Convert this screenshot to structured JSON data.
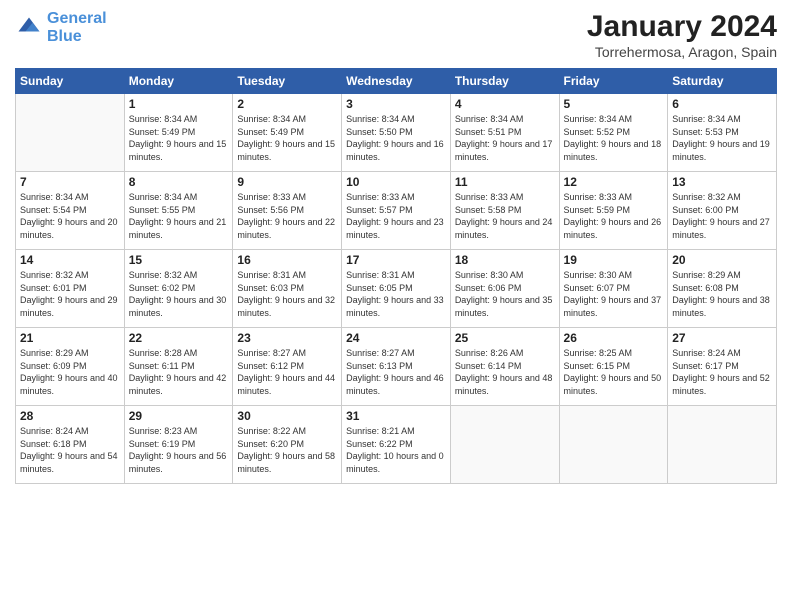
{
  "header": {
    "logo_line1": "General",
    "logo_line2": "Blue",
    "month_year": "January 2024",
    "location": "Torrehermosa, Aragon, Spain"
  },
  "days_of_week": [
    "Sunday",
    "Monday",
    "Tuesday",
    "Wednesday",
    "Thursday",
    "Friday",
    "Saturday"
  ],
  "weeks": [
    [
      {
        "num": "",
        "detail": ""
      },
      {
        "num": "1",
        "detail": "Sunrise: 8:34 AM\nSunset: 5:49 PM\nDaylight: 9 hours\nand 15 minutes."
      },
      {
        "num": "2",
        "detail": "Sunrise: 8:34 AM\nSunset: 5:49 PM\nDaylight: 9 hours\nand 15 minutes."
      },
      {
        "num": "3",
        "detail": "Sunrise: 8:34 AM\nSunset: 5:50 PM\nDaylight: 9 hours\nand 16 minutes."
      },
      {
        "num": "4",
        "detail": "Sunrise: 8:34 AM\nSunset: 5:51 PM\nDaylight: 9 hours\nand 17 minutes."
      },
      {
        "num": "5",
        "detail": "Sunrise: 8:34 AM\nSunset: 5:52 PM\nDaylight: 9 hours\nand 18 minutes."
      },
      {
        "num": "6",
        "detail": "Sunrise: 8:34 AM\nSunset: 5:53 PM\nDaylight: 9 hours\nand 19 minutes."
      }
    ],
    [
      {
        "num": "7",
        "detail": "Sunrise: 8:34 AM\nSunset: 5:54 PM\nDaylight: 9 hours\nand 20 minutes."
      },
      {
        "num": "8",
        "detail": "Sunrise: 8:34 AM\nSunset: 5:55 PM\nDaylight: 9 hours\nand 21 minutes."
      },
      {
        "num": "9",
        "detail": "Sunrise: 8:33 AM\nSunset: 5:56 PM\nDaylight: 9 hours\nand 22 minutes."
      },
      {
        "num": "10",
        "detail": "Sunrise: 8:33 AM\nSunset: 5:57 PM\nDaylight: 9 hours\nand 23 minutes."
      },
      {
        "num": "11",
        "detail": "Sunrise: 8:33 AM\nSunset: 5:58 PM\nDaylight: 9 hours\nand 24 minutes."
      },
      {
        "num": "12",
        "detail": "Sunrise: 8:33 AM\nSunset: 5:59 PM\nDaylight: 9 hours\nand 26 minutes."
      },
      {
        "num": "13",
        "detail": "Sunrise: 8:32 AM\nSunset: 6:00 PM\nDaylight: 9 hours\nand 27 minutes."
      }
    ],
    [
      {
        "num": "14",
        "detail": "Sunrise: 8:32 AM\nSunset: 6:01 PM\nDaylight: 9 hours\nand 29 minutes."
      },
      {
        "num": "15",
        "detail": "Sunrise: 8:32 AM\nSunset: 6:02 PM\nDaylight: 9 hours\nand 30 minutes."
      },
      {
        "num": "16",
        "detail": "Sunrise: 8:31 AM\nSunset: 6:03 PM\nDaylight: 9 hours\nand 32 minutes."
      },
      {
        "num": "17",
        "detail": "Sunrise: 8:31 AM\nSunset: 6:05 PM\nDaylight: 9 hours\nand 33 minutes."
      },
      {
        "num": "18",
        "detail": "Sunrise: 8:30 AM\nSunset: 6:06 PM\nDaylight: 9 hours\nand 35 minutes."
      },
      {
        "num": "19",
        "detail": "Sunrise: 8:30 AM\nSunset: 6:07 PM\nDaylight: 9 hours\nand 37 minutes."
      },
      {
        "num": "20",
        "detail": "Sunrise: 8:29 AM\nSunset: 6:08 PM\nDaylight: 9 hours\nand 38 minutes."
      }
    ],
    [
      {
        "num": "21",
        "detail": "Sunrise: 8:29 AM\nSunset: 6:09 PM\nDaylight: 9 hours\nand 40 minutes."
      },
      {
        "num": "22",
        "detail": "Sunrise: 8:28 AM\nSunset: 6:11 PM\nDaylight: 9 hours\nand 42 minutes."
      },
      {
        "num": "23",
        "detail": "Sunrise: 8:27 AM\nSunset: 6:12 PM\nDaylight: 9 hours\nand 44 minutes."
      },
      {
        "num": "24",
        "detail": "Sunrise: 8:27 AM\nSunset: 6:13 PM\nDaylight: 9 hours\nand 46 minutes."
      },
      {
        "num": "25",
        "detail": "Sunrise: 8:26 AM\nSunset: 6:14 PM\nDaylight: 9 hours\nand 48 minutes."
      },
      {
        "num": "26",
        "detail": "Sunrise: 8:25 AM\nSunset: 6:15 PM\nDaylight: 9 hours\nand 50 minutes."
      },
      {
        "num": "27",
        "detail": "Sunrise: 8:24 AM\nSunset: 6:17 PM\nDaylight: 9 hours\nand 52 minutes."
      }
    ],
    [
      {
        "num": "28",
        "detail": "Sunrise: 8:24 AM\nSunset: 6:18 PM\nDaylight: 9 hours\nand 54 minutes."
      },
      {
        "num": "29",
        "detail": "Sunrise: 8:23 AM\nSunset: 6:19 PM\nDaylight: 9 hours\nand 56 minutes."
      },
      {
        "num": "30",
        "detail": "Sunrise: 8:22 AM\nSunset: 6:20 PM\nDaylight: 9 hours\nand 58 minutes."
      },
      {
        "num": "31",
        "detail": "Sunrise: 8:21 AM\nSunset: 6:22 PM\nDaylight: 10 hours\nand 0 minutes."
      },
      {
        "num": "",
        "detail": ""
      },
      {
        "num": "",
        "detail": ""
      },
      {
        "num": "",
        "detail": ""
      }
    ]
  ]
}
